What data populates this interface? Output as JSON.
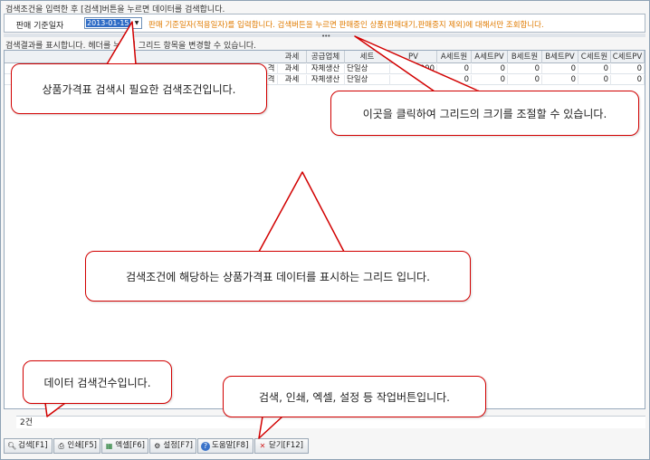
{
  "search": {
    "hint": "검색조건을 입력한 후 [검색]버튼을 누르면 데이터를 검색합니다.",
    "label": "판매 기준일자",
    "date_value": "2013-01-15",
    "description": "판매 기준일자(적용일자)를 입력합니다. 검색버튼을 누르면 판매중인 상품(판매대기,판매중지 제외)에 대해서만 조회합니다."
  },
  "result": {
    "hint": "검색결과를 표시합니다. 헤더를 누르면 그리드 항목을 변경할 수 있습니다.",
    "columns": [
      "과세",
      "공급업체",
      "세트",
      "PV",
      "A세트원",
      "A세트PV",
      "B세트원",
      "B세트PV",
      "C세트원",
      "C세트PV"
    ],
    "rows": [
      {
        "c0": "격",
        "tax": "과세",
        "vendor": "자체생산",
        "set": "단일상",
        "pv": "100,000",
        "a": "0",
        "apv": "0",
        "b": "0",
        "bpv": "0",
        "c": "0",
        "cpv": "0"
      },
      {
        "c0": "격",
        "tax": "과세",
        "vendor": "자체생산",
        "set": "단일상",
        "pv": "",
        "a": "0",
        "apv": "0",
        "b": "0",
        "bpv": "0",
        "c": "0",
        "cpv": "0"
      }
    ],
    "count": "2건"
  },
  "toolbar": {
    "search": "검색[F1]",
    "print": "인쇄[F5]",
    "excel": "엑셀[F6]",
    "settings": "설정[F7]",
    "help": "도움말[F8]",
    "close": "닫기[F12]"
  },
  "callouts": {
    "search_condition": "상품가격표 검색시 필요한 검색조건입니다.",
    "grid_resize": "이곳을 클릭하여 그리드의  크기를 조절할 수 있습니다.",
    "grid": "검색조건에 해당하는 상품가격표 데이터를 표시하는 그리드 입니다.",
    "count": "데이터 검색건수입니다.",
    "buttons": "검색, 인쇄, 엑셀, 설정 등 작업버튼입니다."
  },
  "colors": {
    "callout_border": "#d20000",
    "accent_text": "#e07b00",
    "selection": "#2e6cc6"
  },
  "icons": [
    "search-icon",
    "print-icon",
    "excel-icon",
    "gear-icon",
    "help-icon",
    "close-icon",
    "chevron-down-icon"
  ]
}
